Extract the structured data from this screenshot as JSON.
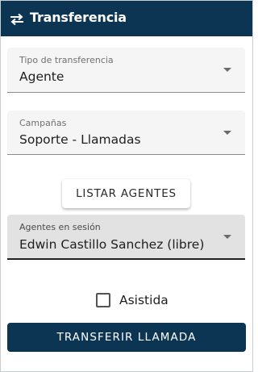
{
  "header": {
    "title": "Transferencia",
    "icon": "swap-arrows-icon"
  },
  "transfer_type": {
    "label": "Tipo de transferencia",
    "value": "Agente"
  },
  "campaigns": {
    "label": "Campañas",
    "value": "Soporte - Llamadas"
  },
  "list_agents_button": {
    "label": "LISTAR AGENTES"
  },
  "agents_session": {
    "label": "Agentes en sesión",
    "value": "Edwin Castillo Sanchez (libre)"
  },
  "assisted": {
    "label": "Asistida",
    "checked": false
  },
  "transfer_button": {
    "label": "TRANSFERIR LLAMADA"
  },
  "colors": {
    "primary": "#0c3554",
    "field_bg": "#f5f5f5",
    "field_active_bg": "#e2e2e2"
  }
}
